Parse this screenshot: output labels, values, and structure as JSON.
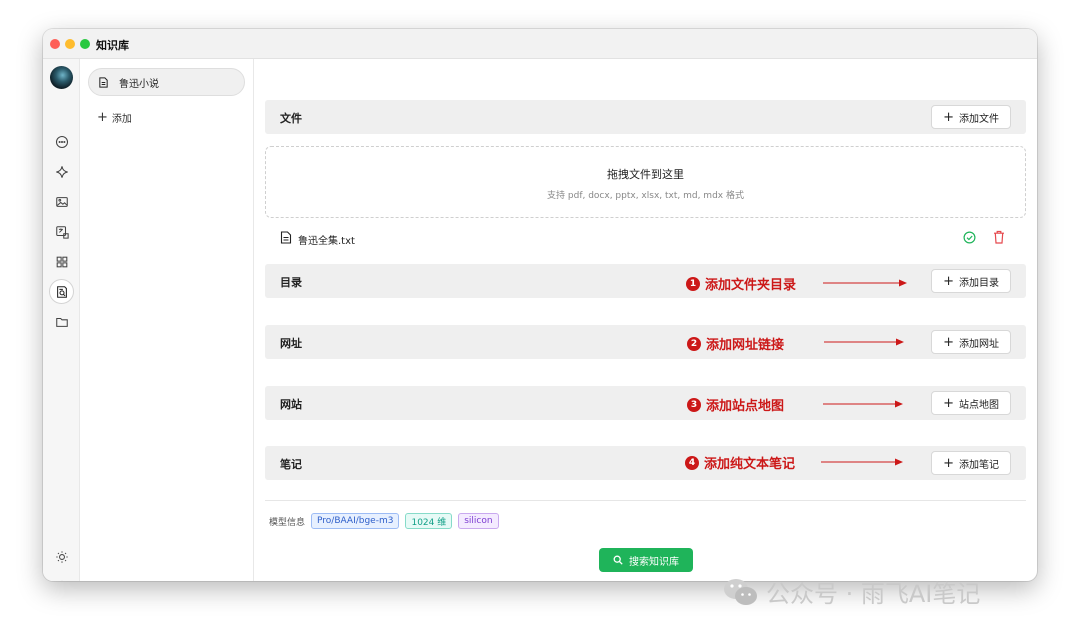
{
  "app": {
    "title": "知识库"
  },
  "knowledge_base": {
    "items": [
      {
        "label": "鲁迅小说"
      }
    ],
    "add_label": "添加"
  },
  "sections": {
    "files": {
      "title": "文件",
      "button": "添加文件"
    },
    "dropzone": {
      "title": "拖拽文件到这里",
      "subtitle": "支持 pdf, docx, pptx, xlsx, txt, md, mdx 格式"
    },
    "file_list": [
      {
        "name": "鲁迅全集.txt",
        "status": "processed"
      }
    ],
    "directory": {
      "title": "目录",
      "button": "添加目录"
    },
    "url": {
      "title": "网址",
      "button": "添加网址"
    },
    "website": {
      "title": "网站",
      "button": "站点地图"
    },
    "notes": {
      "title": "笔记",
      "button": "添加笔记"
    }
  },
  "annotations": [
    {
      "number": "1",
      "text": "添加文件夹目录"
    },
    {
      "number": "2",
      "text": "添加网址链接"
    },
    {
      "number": "3",
      "text": "添加站点地图"
    },
    {
      "number": "4",
      "text": "添加纯文本笔记"
    }
  ],
  "model_info": {
    "label": "模型信息",
    "model": "Pro/BAAI/bge-m3",
    "dimensions": "1024 维",
    "provider": "silicon"
  },
  "search_button": "搜索知识库",
  "watermark": {
    "text": "公众号 · 雨飞AI笔记"
  },
  "colors": {
    "accent_green": "#1fb45a",
    "annotation_red": "#cc1818",
    "delete_red": "#e5484d"
  }
}
